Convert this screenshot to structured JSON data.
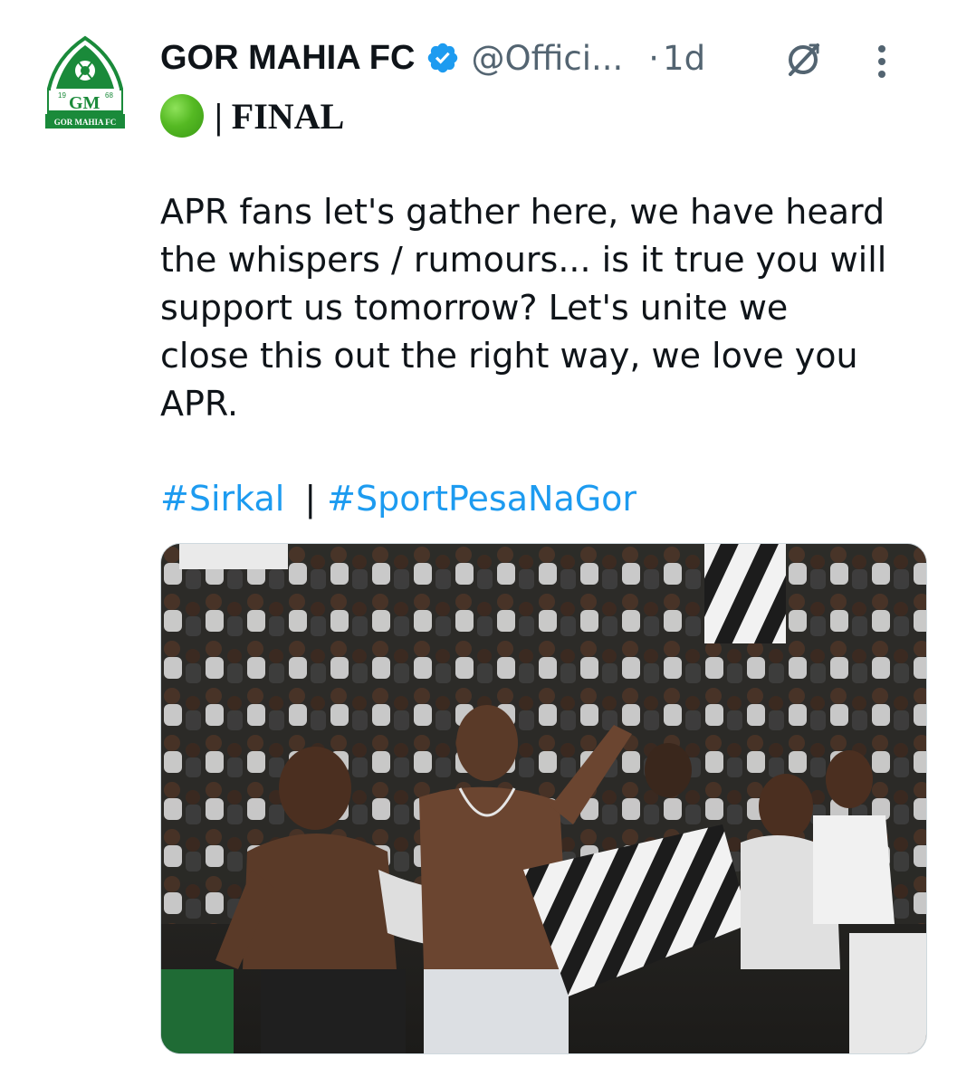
{
  "tweet": {
    "author_name": "GOR MAHIA FC",
    "handle": "@Offici...",
    "separator_dot": "·",
    "time": "1d",
    "verified_color": "#1d9bf0",
    "avatar": {
      "logo_lettering": "GOR MAHIA FC",
      "year_left": "19",
      "year_right": "68"
    },
    "status_emoji_icon": "green-circle-icon",
    "final_label": "| FINAL",
    "body_lines": [
      "APR fans let's gather here, we have heard",
      "the whispers / rumours... is it true you will",
      "support us tomorrow? Let's unite we",
      "close this out the right way, we love you",
      "APR."
    ],
    "hashtags": [
      "#Sirkal",
      "#SportPesaNaGor"
    ],
    "hashtag_separator": "|",
    "hashtag_color": "#1d9bf0"
  },
  "icons": {
    "grok": "grok-icon",
    "more": "more-options-icon"
  }
}
